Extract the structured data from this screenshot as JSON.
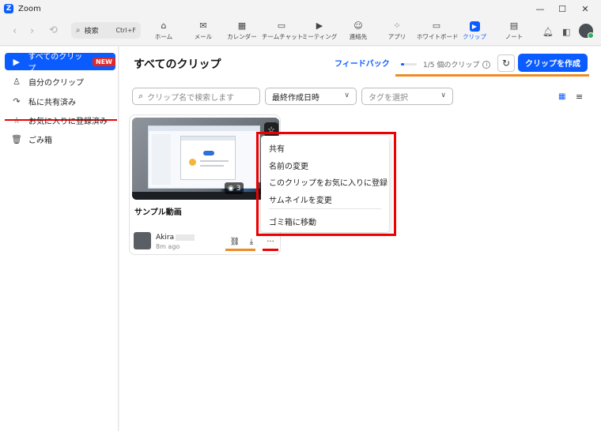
{
  "window": {
    "title": "Zoom",
    "logo_letter": "Z"
  },
  "toolbar": {
    "search_label": "検索",
    "search_shortcut": "Ctrl+F",
    "tabs": [
      {
        "label": "ホーム",
        "icon": "home-icon"
      },
      {
        "label": "メール",
        "icon": "mail-icon"
      },
      {
        "label": "カレンダー",
        "icon": "calendar-icon"
      },
      {
        "label": "チームチャット",
        "icon": "chat-icon"
      },
      {
        "label": "ミーティング",
        "icon": "video-icon"
      },
      {
        "label": "連絡先",
        "icon": "contacts-icon"
      },
      {
        "label": "アプリ",
        "icon": "apps-icon"
      },
      {
        "label": "ホワイトボード",
        "icon": "whiteboard-icon"
      },
      {
        "label": "クリップ",
        "icon": "clips-icon",
        "active": true
      },
      {
        "label": "ノート",
        "icon": "notes-icon"
      }
    ]
  },
  "sidebar": {
    "items": [
      {
        "label": "すべてのクリップ",
        "icon": "play-square-icon",
        "badge": "NEW",
        "active": true
      },
      {
        "label": "自分のクリップ",
        "icon": "person-icon"
      },
      {
        "label": "私に共有済み",
        "icon": "share-icon"
      },
      {
        "label": "お気に入りに登録済み",
        "icon": "star-icon"
      },
      {
        "label": "ごみ箱",
        "icon": "trash-icon"
      }
    ]
  },
  "main": {
    "title": "すべてのクリップ",
    "feedback": "フィードバック",
    "quota": {
      "text": "1/5 個のクリップ",
      "used": 1,
      "limit": 5
    },
    "create_label": "クリップを作成",
    "search_placeholder": "クリップ名で検索します",
    "sort_label": "最終作成日時",
    "tag_placeholder": "タグを選択"
  },
  "clip": {
    "title": "サンプル動画",
    "owner": "Akira",
    "time": "8m ago",
    "views": "3",
    "duration": "35"
  },
  "context_menu": {
    "items": [
      {
        "label": "共有"
      },
      {
        "label": "名前の変更"
      },
      {
        "label": "このクリップをお気に入りに登録"
      },
      {
        "label": "サムネイルを変更"
      },
      {
        "label": "ゴミ箱に移動"
      }
    ]
  },
  "colors": {
    "accent": "#0b5cff",
    "highlight_red": "#ee0000",
    "highlight_orange": "#f08a24",
    "badge_red": "#e02828"
  }
}
